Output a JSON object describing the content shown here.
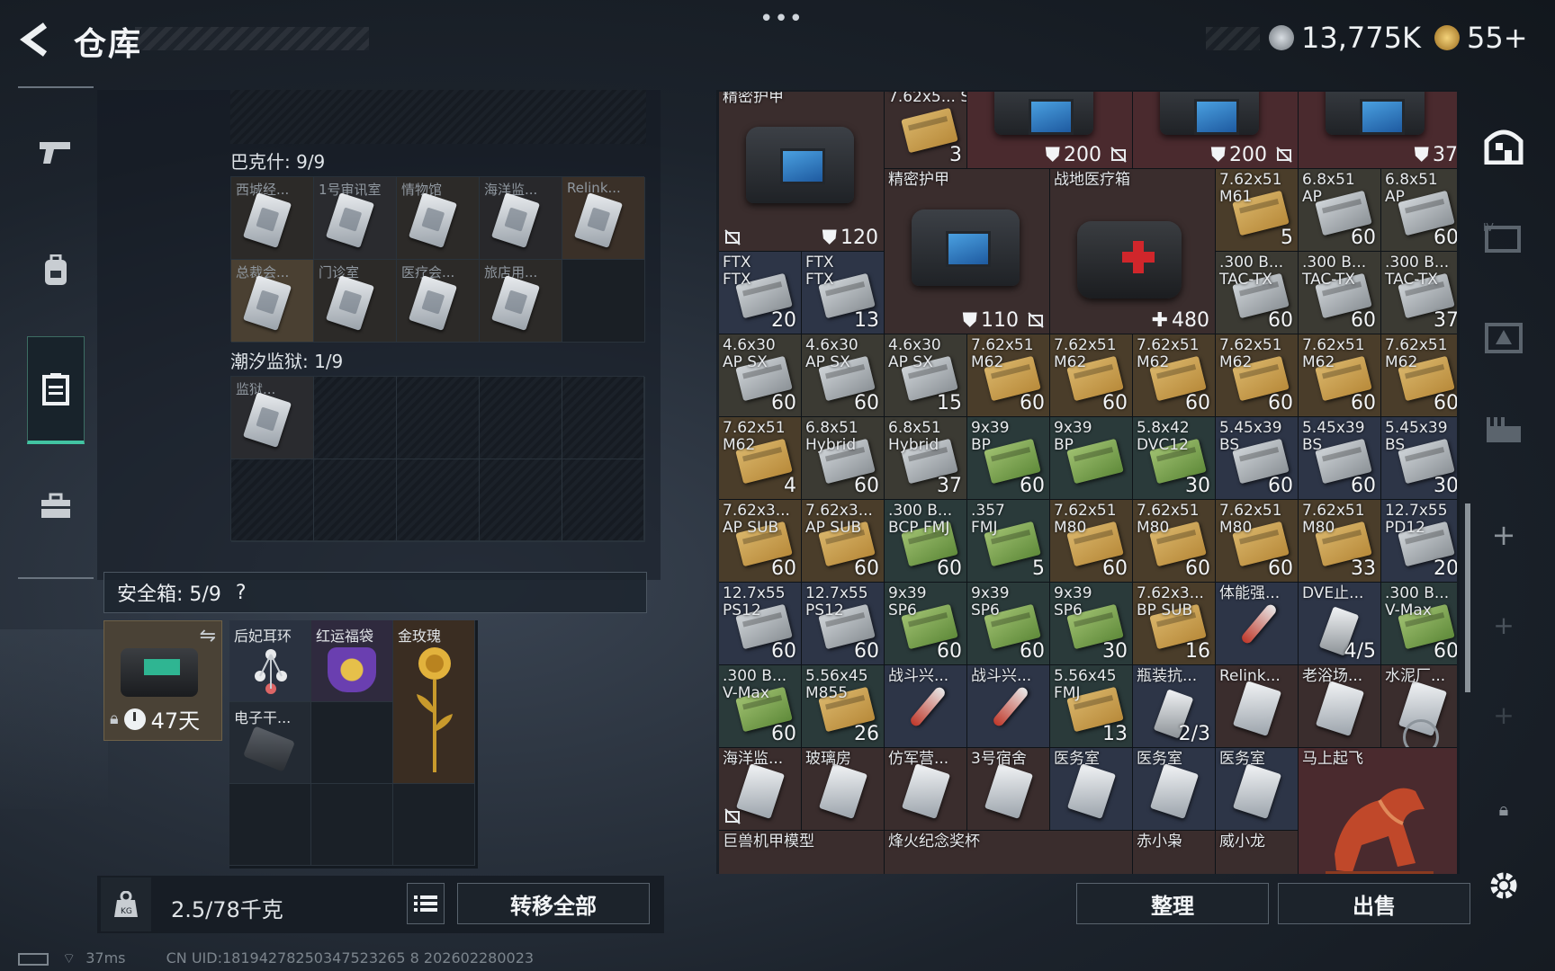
{
  "header": {
    "title": "仓库",
    "currency_main": "13,775K",
    "currency_premium": "55+"
  },
  "left": {
    "bakesh_label": "巴克什: 9/9",
    "bakesh_items": [
      "西城经...",
      "1号审讯室",
      "情物馆",
      "海洋监...",
      "Relink...",
      "总裁会...",
      "门诊室",
      "医疗会...",
      "旅店用..."
    ],
    "tide_label": "潮汐监狱: 1/9",
    "tide_items": [
      "监狱..."
    ],
    "safebox_label": "安全箱: 5/9",
    "safebox_help": "?",
    "safebox_days": "47天",
    "safebox_items": [
      "后妃耳环",
      "红运福袋",
      "金玫瑰",
      "电子干..."
    ],
    "weight": "2.5/78千克",
    "transfer_all": "转移全部"
  },
  "inventory": {
    "row0": [
      {
        "name": "精密护甲",
        "dur": "120"
      },
      {
        "name": "7.62x5... SNB",
        "qty": "3"
      },
      {
        "name": "",
        "dur": "200"
      },
      {
        "name": "",
        "dur": "200"
      },
      {
        "name": "",
        "dur": "37"
      }
    ],
    "armor2": {
      "name": "精密护甲",
      "dur": "110"
    },
    "medkit": {
      "name": "战地医疗箱",
      "dur": "480"
    },
    "ammo": [
      {
        "name": "7.62x51\nM61",
        "qty": "5"
      },
      {
        "name": "6.8x51\nAP",
        "qty": "60"
      },
      {
        "name": "6.8x51\nAP",
        "qty": "60"
      },
      {
        "name": "FTX\nFTX",
        "qty": "20"
      },
      {
        "name": "FTX\nFTX",
        "qty": "13"
      },
      {
        "name": ".300 B...\nTAC-TX",
        "qty": "60"
      },
      {
        "name": ".300 B...\nTAC-TX",
        "qty": "60"
      },
      {
        "name": ".300 B...\nTAC-TX",
        "qty": "37"
      },
      {
        "name": "4.6x30\nAP SX",
        "qty": "60"
      },
      {
        "name": "4.6x30\nAP SX",
        "qty": "60"
      },
      {
        "name": "4.6x30\nAP SX",
        "qty": "15"
      },
      {
        "name": "7.62x51\nM62",
        "qty": "60"
      },
      {
        "name": "7.62x51\nM62",
        "qty": "60"
      },
      {
        "name": "7.62x51\nM62",
        "qty": "60"
      },
      {
        "name": "7.62x51\nM62",
        "qty": "60"
      },
      {
        "name": "7.62x51\nM62",
        "qty": "60"
      },
      {
        "name": "7.62x51\nM62",
        "qty": "60"
      },
      {
        "name": "7.62x51\nM62",
        "qty": "4"
      },
      {
        "name": "6.8x51\nHybrid",
        "qty": "60"
      },
      {
        "name": "6.8x51\nHybrid",
        "qty": "37"
      },
      {
        "name": "9x39\nBP",
        "qty": "60"
      },
      {
        "name": "9x39\nBP",
        "qty": ""
      },
      {
        "name": "5.8x42\nDVC12",
        "qty": "30"
      },
      {
        "name": "5.45x39\nBS",
        "qty": "60"
      },
      {
        "name": "5.45x39\nBS",
        "qty": "60"
      },
      {
        "name": "5.45x39\nBS",
        "qty": "30"
      },
      {
        "name": "7.62x3...\nAP SUB",
        "qty": "60"
      },
      {
        "name": "7.62x3...\nAP SUB",
        "qty": "60"
      },
      {
        "name": ".300 B...\nBCP FMJ",
        "qty": "60"
      },
      {
        "name": ".357\nFMJ",
        "qty": "5"
      },
      {
        "name": "7.62x51\nM80",
        "qty": "60"
      },
      {
        "name": "7.62x51\nM80",
        "qty": "60"
      },
      {
        "name": "7.62x51\nM80",
        "qty": "60"
      },
      {
        "name": "7.62x51\nM80",
        "qty": "33"
      },
      {
        "name": "12.7x55\nPD12",
        "qty": "20"
      },
      {
        "name": "12.7x55\nPS12",
        "qty": "60"
      },
      {
        "name": "12.7x55\nPS12",
        "qty": "60"
      },
      {
        "name": "9x39\nSP6",
        "qty": "60"
      },
      {
        "name": "9x39\nSP6",
        "qty": "60"
      },
      {
        "name": "9x39\nSP6",
        "qty": "30"
      },
      {
        "name": "7.62x3...\nBP SUB",
        "qty": "16"
      },
      {
        "name": "体能强...",
        "qty": ""
      },
      {
        "name": "DVE止...",
        "qty": "4/5"
      },
      {
        "name": ".300 B...\nV-Max",
        "qty": "60"
      },
      {
        "name": ".300 B...\nV-Max",
        "qty": "60"
      },
      {
        "name": "5.56x45\nM855",
        "qty": "26"
      },
      {
        "name": "战斗兴...",
        "qty": ""
      },
      {
        "name": "战斗兴...",
        "qty": ""
      },
      {
        "name": "5.56x45\nFMJ",
        "qty": "13"
      },
      {
        "name": "瓶装抗...",
        "qty": "2/3"
      },
      {
        "name": "Relink...",
        "qty": ""
      },
      {
        "name": "老浴场...",
        "qty": ""
      },
      {
        "name": "水泥厂...",
        "qty": ""
      }
    ],
    "keys": [
      "海洋监...",
      "玻璃房",
      "仿军营...",
      "3号宿舍",
      "医务室",
      "医务室",
      "医务室"
    ],
    "horse": "马上起飞",
    "bottom_row": [
      "巨兽机甲模型",
      "烽火纪念奖杯",
      "赤小枭",
      "威小龙"
    ],
    "sort_label": "整理",
    "sell_label": "出售"
  },
  "status": {
    "ping": "37ms",
    "uid": "CN UID:18194278250347523265 8 202602280023"
  },
  "colors": {
    "accent": "#42c4a2",
    "ammo_tan": "#b88a3a",
    "ammo_green": "#5f8a3a",
    "ammo_gray": "#8b9196"
  }
}
